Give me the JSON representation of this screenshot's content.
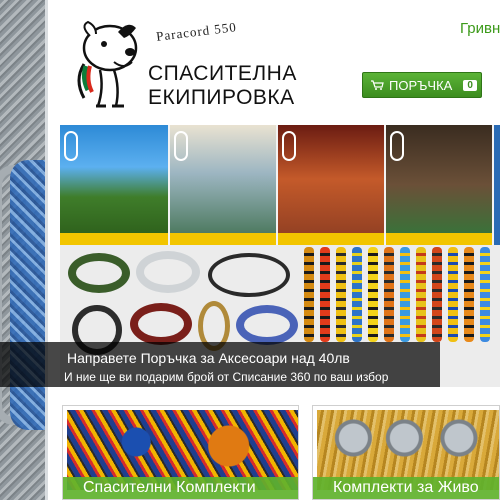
{
  "header": {
    "currency_link": "Гривн",
    "logo": {
      "tagline": "Paracord 550",
      "brand_line_1": "СПАСИТЕЛНА",
      "brand_line_2": "ЕКИПИРОВКА",
      "icon": "dog-mascot-logo"
    },
    "order_button": {
      "label": "ПОРЪЧКА",
      "count": "0",
      "icon": "cart-icon"
    }
  },
  "hero": {
    "title": "Направете Поръчка за Аксесоари над 40лв",
    "subtitle": "И ние ще ви подарим брой от Списание 360 по ваш избор"
  },
  "tiles": [
    {
      "label": "Спасителни Комплекти"
    },
    {
      "label": "Комплекти за Живо"
    }
  ],
  "colors": {
    "accent_green": "#4aa526",
    "link_green": "#3c9a1a",
    "caption_bg": "#000000"
  }
}
